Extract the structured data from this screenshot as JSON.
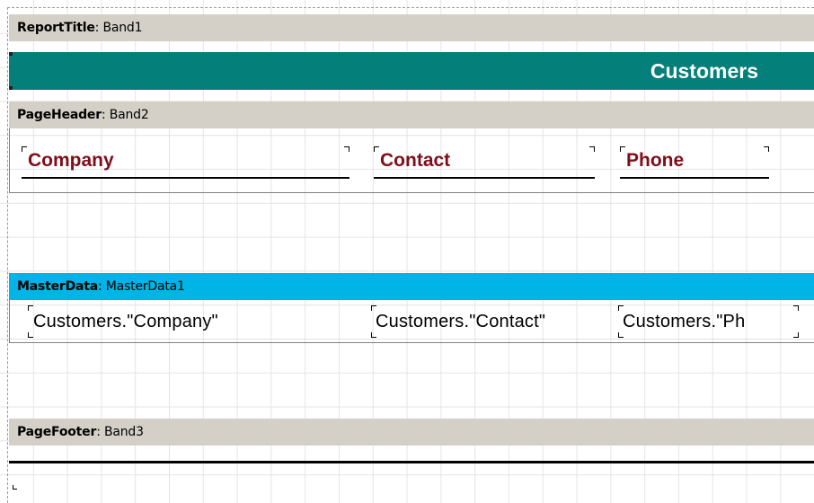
{
  "report_title_band": {
    "type_label": "ReportTitle",
    "separator": ": ",
    "name": "Band1"
  },
  "title": {
    "text": "Customers",
    "background": "#047f7a",
    "color": "#ffffff"
  },
  "page_header_band": {
    "type_label": "PageHeader",
    "separator": ": ",
    "name": "Band2"
  },
  "column_headers": [
    {
      "text": "Company",
      "color": "#7f0d1a"
    },
    {
      "text": "Contact",
      "color": "#7f0d1a"
    },
    {
      "text": "Phone",
      "color": "#7f0d1a"
    }
  ],
  "master_data_band": {
    "type_label": "MasterData",
    "separator": ": ",
    "name": "MasterData1",
    "color": "#00b4e6"
  },
  "data_fields": [
    {
      "text": "Customers.\"Company\""
    },
    {
      "text": "Customers.\"Contact\""
    },
    {
      "text": "Customers.\"Ph"
    }
  ],
  "page_footer_band": {
    "type_label": "PageFooter",
    "separator": ": ",
    "name": "Band3"
  },
  "band_header_color": "#d4d0c8"
}
